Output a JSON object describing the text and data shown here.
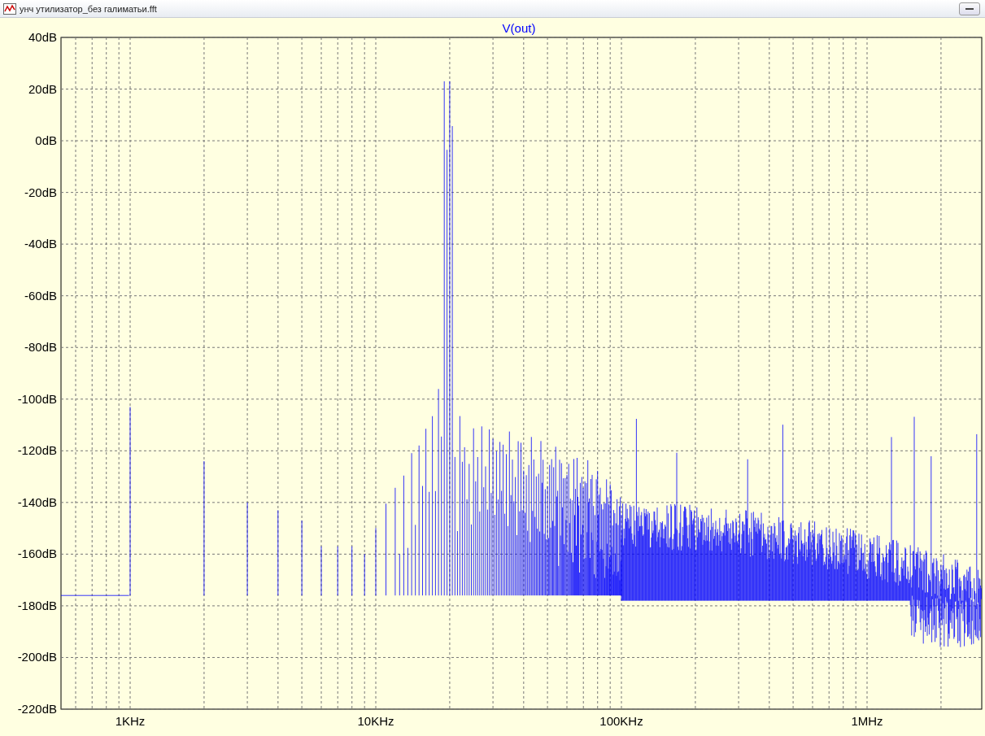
{
  "window": {
    "title": "унч утилизатор_без галиматьи.fft"
  },
  "plot": {
    "trace_name": "V(out)",
    "y_axis_labels": [
      "40dB",
      "20dB",
      "0dB",
      "-20dB",
      "-40dB",
      "-60dB",
      "-80dB",
      "-100dB",
      "-120dB",
      "-140dB",
      "-160dB",
      "-180dB",
      "-200dB",
      "-220dB"
    ],
    "x_axis_labels": [
      "1KHz",
      "10KHz",
      "100KHz",
      "1MHz"
    ]
  }
}
